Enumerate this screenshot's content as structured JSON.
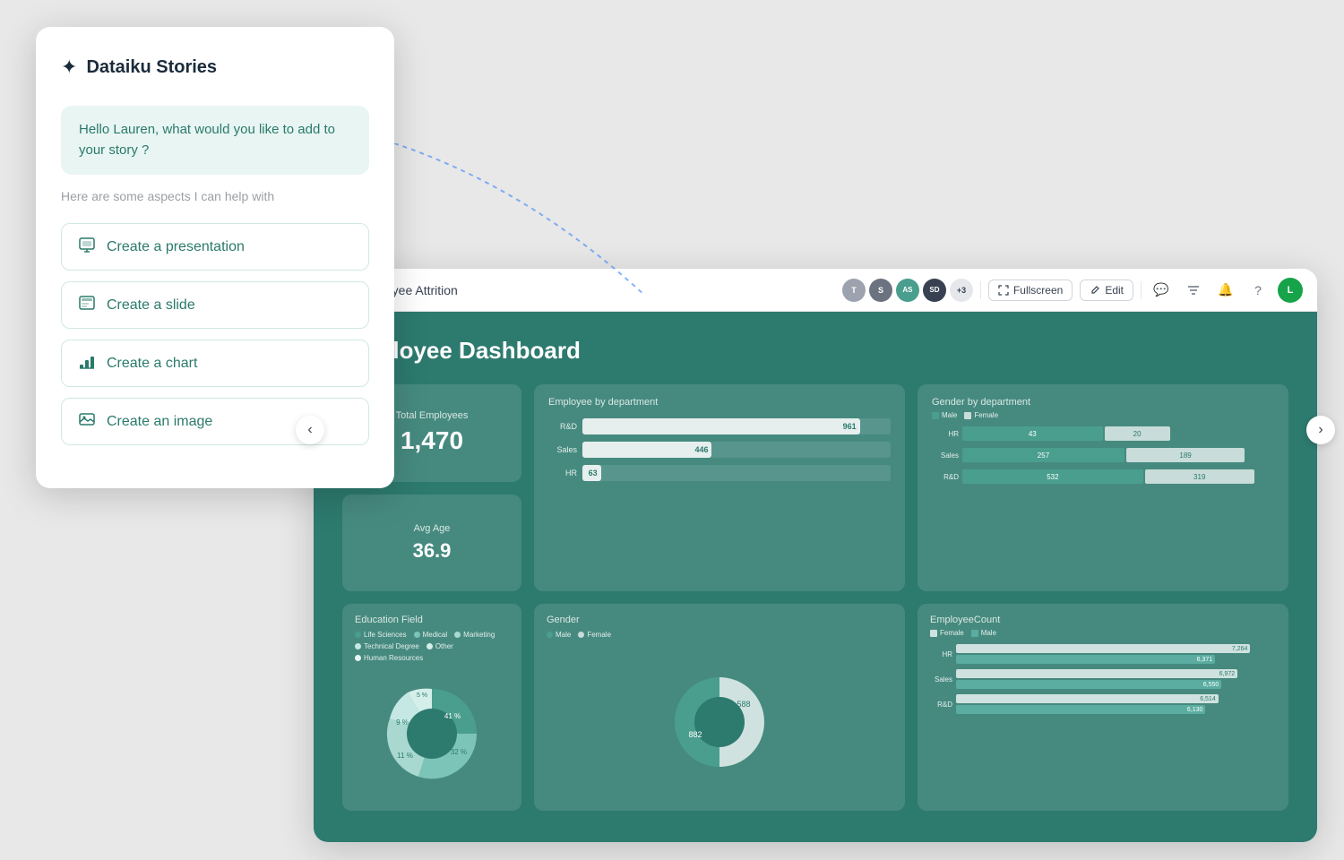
{
  "app": {
    "title": "Dataiku Stories"
  },
  "ai_panel": {
    "greeting": "Hello Lauren, what would you like to add to your story ?",
    "subtitle": "Here are some aspects I can help with",
    "options": [
      {
        "id": "presentation",
        "label": "Create a presentation",
        "icon": "🖥"
      },
      {
        "id": "slide",
        "label": "Create a slide",
        "icon": "📋"
      },
      {
        "id": "chart",
        "label": "Create a chart",
        "icon": "📊"
      },
      {
        "id": "image",
        "label": "Create an image",
        "icon": "🖼"
      }
    ]
  },
  "toolbar": {
    "story_title": "Employee Attrition",
    "fullscreen_label": "Fullscreen",
    "edit_label": "Edit",
    "avatars": [
      {
        "label": "T",
        "color": "#6b7280"
      },
      {
        "label": "S",
        "color": "#9ca3af"
      },
      {
        "label": "AS",
        "color": "#4a9e8e"
      },
      {
        "label": "SD",
        "color": "#374151"
      }
    ],
    "more_label": "+3"
  },
  "dashboard": {
    "title": "Employee Dashboard",
    "total_employees_label": "Total Employees",
    "total_employees_value": "1,470",
    "avg_age_label": "Avg Age",
    "avg_age_value": "36.9",
    "dept_chart_title": "Employee by department",
    "dept_bars": [
      {
        "label": "R&D",
        "value": 961,
        "pct": 90
      },
      {
        "label": "Sales",
        "value": 446,
        "pct": 42
      },
      {
        "label": "HR",
        "value": 63,
        "pct": 6
      }
    ],
    "gender_dept_title": "Gender by department",
    "gender_dept_legend": [
      "Male",
      "Female"
    ],
    "gender_dept_bars": [
      {
        "label": "HR",
        "male": 43,
        "female": 20,
        "male_pct": 62,
        "female_pct": 29
      },
      {
        "label": "Sales",
        "male": 257,
        "female": 189,
        "male_pct": 52,
        "female_pct": 38
      },
      {
        "label": "R&D",
        "male": 532,
        "female": 319,
        "male_pct": 60,
        "female_pct": 36
      }
    ],
    "education_title": "Education Field",
    "education_legend": [
      {
        "label": "Life Sciences",
        "color": "#4a9e8e"
      },
      {
        "label": "Medical",
        "color": "#7dc4b8"
      },
      {
        "label": "Marketing",
        "color": "#a8d8d0"
      },
      {
        "label": "Technical Degree",
        "color": "#c5e8e4"
      },
      {
        "label": "Other",
        "color": "#d4eeea"
      },
      {
        "label": "Human Resources",
        "color": "#e8f5f3"
      }
    ],
    "education_pcts": [
      "41 %",
      "32 %",
      "11 %",
      "9 %",
      "5 %"
    ],
    "gender_title": "Gender",
    "gender_legend": [
      "Male",
      "Female"
    ],
    "gender_values": {
      "male": 588,
      "female": 882
    },
    "emp_count_title": "EmployeeCount",
    "emp_count_legend": [
      "Female",
      "Male"
    ],
    "emp_count_bars": [
      {
        "label": "HR",
        "female": 7264,
        "male": 6371,
        "female_pct": 92,
        "male_pct": 81
      },
      {
        "label": "Sales",
        "female": 6972,
        "male": 6550,
        "female_pct": 88,
        "male_pct": 83
      },
      {
        "label": "R&D",
        "female": 6514,
        "male": 6130,
        "female_pct": 82,
        "male_pct": 78
      }
    ]
  }
}
